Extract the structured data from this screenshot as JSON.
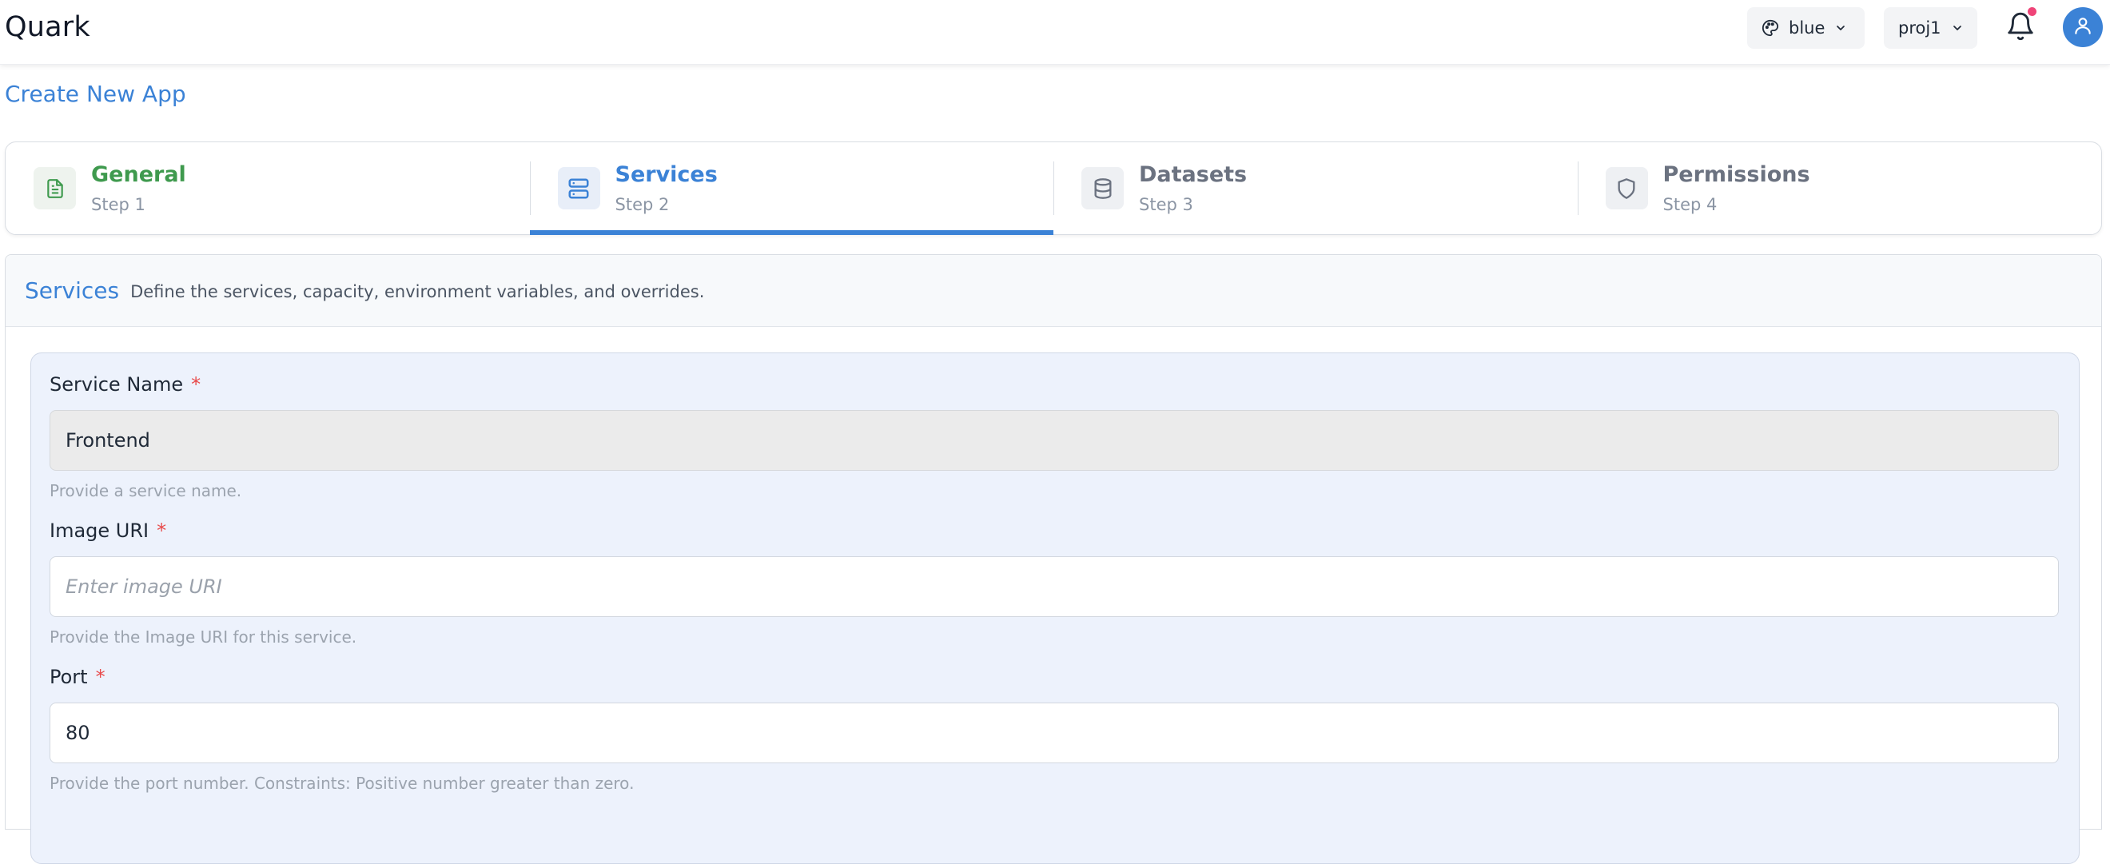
{
  "header": {
    "brand": "Quark",
    "theme_selector": {
      "label": "blue",
      "icon": "palette-icon"
    },
    "project_selector": {
      "label": "proj1"
    },
    "notifications": {
      "icon": "bell-icon",
      "has_unread": true
    },
    "avatar": {
      "icon": "user-icon"
    }
  },
  "page": {
    "title": "Create New App"
  },
  "stepper": {
    "steps": [
      {
        "title": "General",
        "subtitle": "Step 1",
        "icon": "file-text-icon",
        "state": "completed"
      },
      {
        "title": "Services",
        "subtitle": "Step 2",
        "icon": "server-icon",
        "state": "active"
      },
      {
        "title": "Datasets",
        "subtitle": "Step 3",
        "icon": "database-icon",
        "state": "pending"
      },
      {
        "title": "Permissions",
        "subtitle": "Step 4",
        "icon": "shield-icon",
        "state": "pending"
      }
    ]
  },
  "services": {
    "title": "Services",
    "description": "Define the services, capacity, environment variables, and overrides.",
    "fields": {
      "service_name": {
        "label": "Service Name",
        "required_mark": "*",
        "value": "Frontend",
        "help": "Provide a service name."
      },
      "image_uri": {
        "label": "Image URI",
        "required_mark": "*",
        "value": "",
        "placeholder": "Enter image URI",
        "help": "Provide the Image URI for this service."
      },
      "port": {
        "label": "Port",
        "required_mark": "*",
        "value": "80",
        "help": "Provide the port number. Constraints: Positive number greater than zero."
      }
    }
  },
  "colors": {
    "accent": "#3b82d6",
    "completed": "#3f9a4e",
    "required": "#e84a4a",
    "notification_dot": "#ef4478"
  }
}
